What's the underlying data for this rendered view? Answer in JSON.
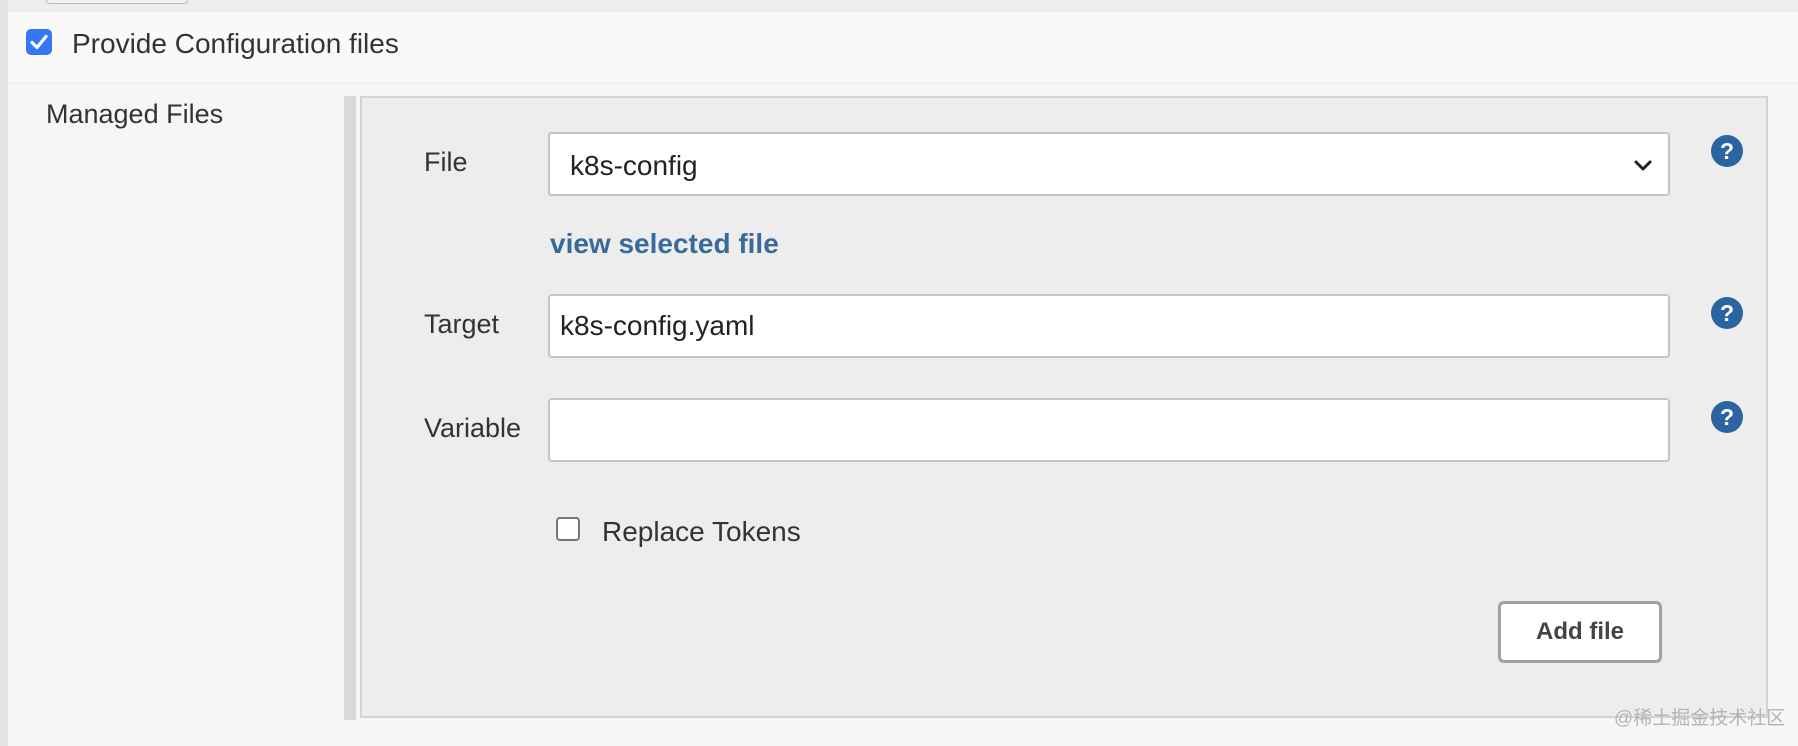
{
  "header": {
    "provide_config_label": "Provide Configuration files",
    "provide_config_checked": true
  },
  "section": {
    "label": "Managed Files"
  },
  "form": {
    "file_label": "File",
    "file_selected": "k8s-config",
    "view_link": "view selected file",
    "target_label": "Target",
    "target_value": "k8s-config.yaml",
    "variable_label": "Variable",
    "variable_value": "",
    "replace_tokens_label": "Replace Tokens",
    "replace_tokens_checked": false,
    "add_button": "Add file"
  },
  "watermark": "@稀土掘金技术社区",
  "colors": {
    "checkbox_blue": "#3478f6",
    "link_blue": "#3a6a9a",
    "help_icon_blue": "#2b64a0"
  },
  "icons": {
    "help": "help-icon",
    "dropdown": "chevron-down-icon",
    "check": "checkmark-icon"
  }
}
